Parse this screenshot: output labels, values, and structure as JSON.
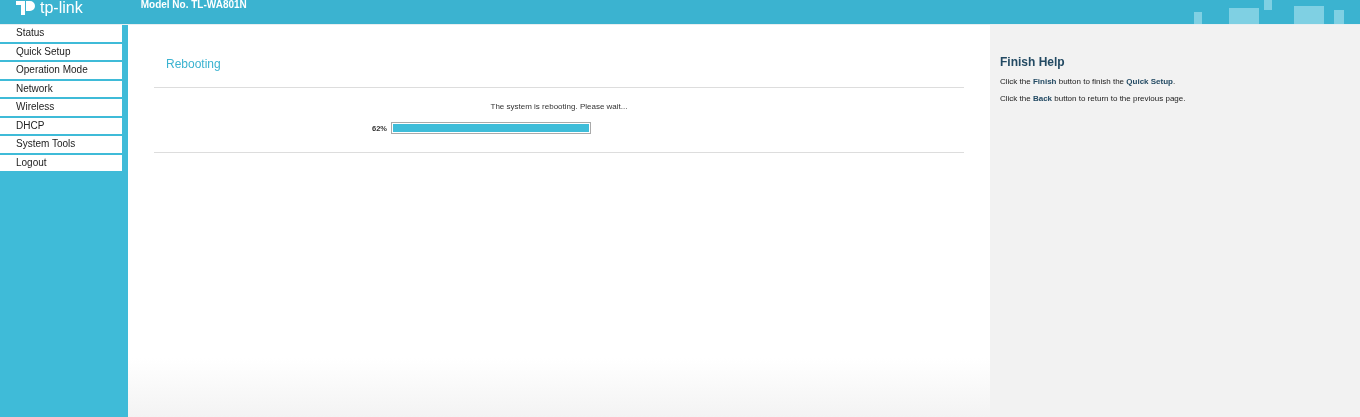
{
  "header": {
    "logo": "tp-link",
    "model": "Model No. TL-WA801N"
  },
  "sidebar": {
    "items": [
      {
        "label": "Status"
      },
      {
        "label": "Quick Setup"
      },
      {
        "label": "Operation Mode"
      },
      {
        "label": "Network"
      },
      {
        "label": "Wireless"
      },
      {
        "label": "DHCP"
      },
      {
        "label": "System Tools"
      },
      {
        "label": "Logout"
      }
    ]
  },
  "main": {
    "title": "Rebooting",
    "message": "The system is rebooting. Please wait...",
    "progress": {
      "reading": "62%",
      "level": 1
    }
  },
  "help": {
    "title": "Finish Help",
    "lines": [
      "Click the **Finish** button to finish the **Quick Setup**.",
      "Click the **Back** button to return to the previous page."
    ]
  }
}
